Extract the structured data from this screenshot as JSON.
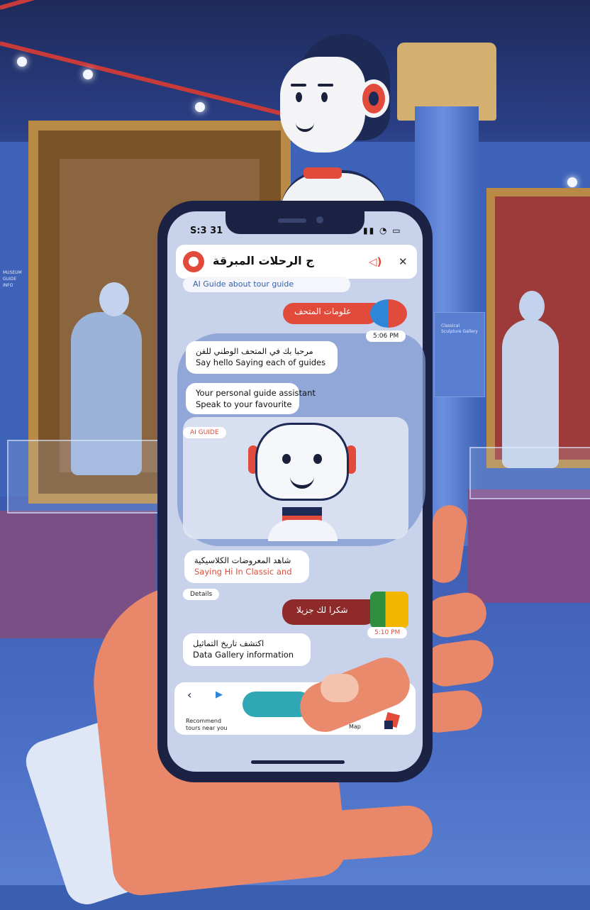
{
  "status_bar": {
    "time": "S:3 31",
    "icons": "▮▮ ◔ ▭"
  },
  "app": {
    "title": "الرحلات المبرقة",
    "title_suffix": "ج",
    "language_chip": "AI Guide about tour guide",
    "icon_names": {
      "logo": "chat-logo-icon",
      "audio": "speaker-icon",
      "close": "close-icon"
    },
    "accent_color": "#e24a3b"
  },
  "chat": {
    "msg_out_1": "علومات المتحف",
    "msg_out_1_time": "5:06 PM",
    "msg_in_1_line1": "مرحبا بك في المتحف الوطني للفن",
    "msg_in_1_line2": "Say hello Saying each of guides",
    "msg_in_2_line1": "Your personal guide assistant",
    "msg_in_2_line2": "Speak to your favourite",
    "sender_label": "AI GUIDE",
    "msg_in_3_line1": "شاهد المعروضات الكلاسيكية",
    "msg_in_3_line2": "Saying Hi In Classic and",
    "timestamp_1": "Details",
    "msg_out_2": "شكرا لك جزيلا",
    "msg_out_2_time": "5:10 PM",
    "msg_in_4_line1": "اكتشف تاريخ التماثيل",
    "msg_in_4_line2": "Data Gallery information"
  },
  "toolbar": {
    "back_icon": "‹",
    "play_icon": "▶",
    "quick_label": "Recommend tours near you",
    "map_label": "Map",
    "menu_icon": "≡"
  },
  "scene": {
    "wall_text": "MUSEUM GUIDE INFO",
    "plaque_text": "Classical Sculpture Gallery"
  }
}
